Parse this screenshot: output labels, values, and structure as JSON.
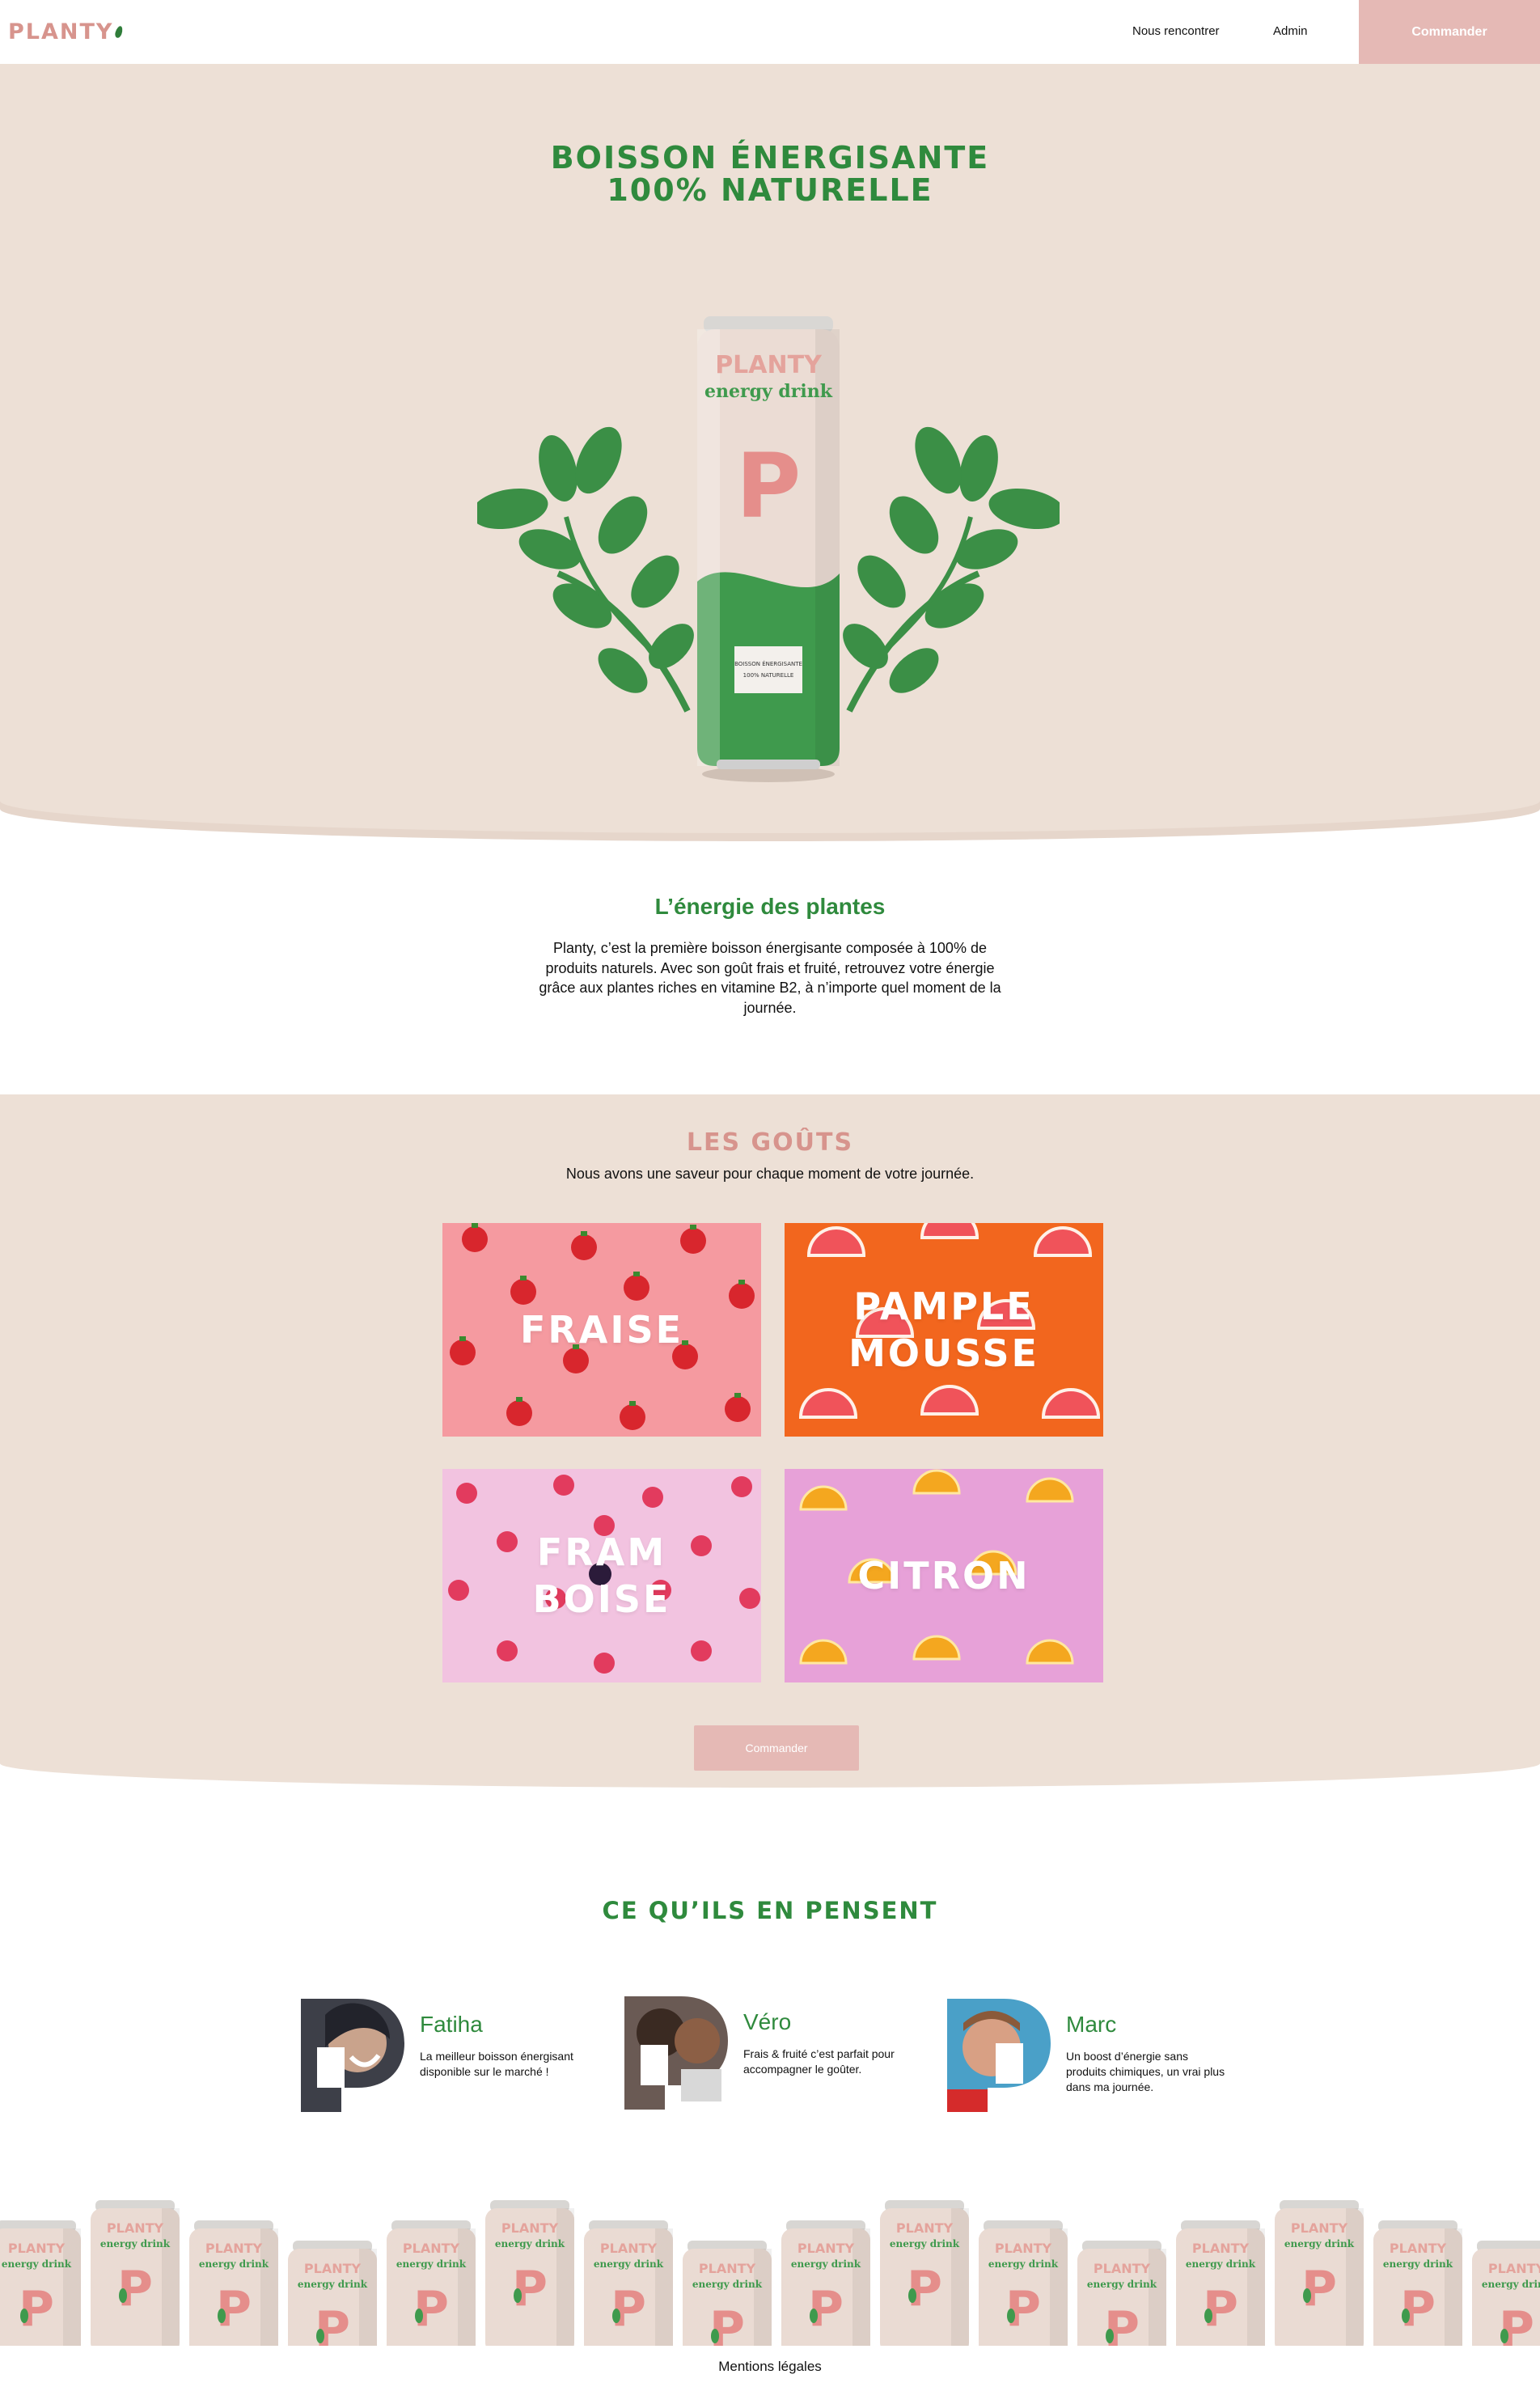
{
  "header": {
    "logo": "PLANTY",
    "nav": {
      "meet": "Nous rencontrer",
      "admin": "Admin"
    },
    "order_label": "Commander"
  },
  "hero": {
    "title_line1": "BOISSON ÉNERGISANTE",
    "title_line2": "100% NATURELLE",
    "can": {
      "brand": "PLANTY",
      "subtitle": "energy drink",
      "letter": "P",
      "label_line1": "BOISSON ÉNERGISANTE",
      "label_line2": "100% NATURELLE"
    }
  },
  "intro": {
    "title": "L’énergie des plantes",
    "text": "Planty, c’est la première boisson énergisante composée à 100% de produits naturels. Avec son goût frais et fruité, retrouvez votre énergie grâce aux plantes riches en vitamine B2, à n’importe quel moment de la journée."
  },
  "tastes": {
    "title": "LES GOÛTS",
    "subtitle": "Nous avons une saveur pour chaque moment de votre journée.",
    "items": [
      {
        "label": "FRAISE"
      },
      {
        "label": "PAMPLE\nMOUSSE"
      },
      {
        "label": "FRAM\nBOISE"
      },
      {
        "label": "CITRON"
      }
    ],
    "order_label": "Commander"
  },
  "testimonials": {
    "title": "CE QU’ILS EN PENSENT",
    "items": [
      {
        "name": "Fatiha",
        "quote": "La meilleur boisson énergisant disponible sur le marché !"
      },
      {
        "name": "Véro",
        "quote": "Frais & fruité c’est parfait pour accompagner le goûter."
      },
      {
        "name": "Marc",
        "quote": "Un boost d’énergie sans produits chimiques, un vrai plus dans ma journée."
      }
    ]
  },
  "footer": {
    "legal": "Mentions légales"
  },
  "colors": {
    "accent_green": "#2f8a3d",
    "accent_pink": "#d7948d",
    "button_pink": "#e5b9b5",
    "beige": "#ede0d6"
  }
}
